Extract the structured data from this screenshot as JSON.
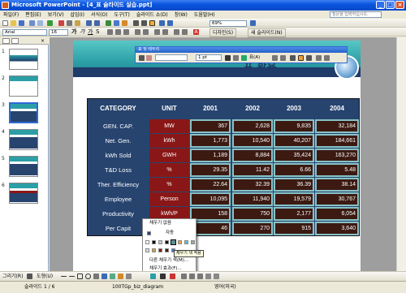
{
  "app": {
    "title": "Microsoft PowerPoint - [4_표 슬라이드 실습.ppt]"
  },
  "menu": [
    "파일(F)",
    "편집(E)",
    "보기(V)",
    "삽입(I)",
    "서식(O)",
    "도구(T)",
    "슬라이드 쇼(D)",
    "창(W)",
    "도움말(H)"
  ],
  "help_box": {
    "placeholder": "질문을 입력하십시오."
  },
  "toolbar": {
    "zoom": "69%",
    "font": "Arial",
    "font_size": "16",
    "design_label": "디자인(S)",
    "new_slide_label": "새 슬라이드(N)"
  },
  "float_toolbar": {
    "title": "표 및 테두리",
    "line_width": "1 pt",
    "table_label": "표(A)"
  },
  "thumbnails": [
    "1",
    "2",
    "3",
    "4",
    "5",
    "6"
  ],
  "table": {
    "headers": [
      "CATEGORY",
      "UNIT",
      "2001",
      "2002",
      "2003",
      "2004"
    ],
    "rows": [
      {
        "category": "GEN. CAP.",
        "unit": "MW",
        "values": [
          "367",
          "2,628",
          "9,835",
          "32,184"
        ]
      },
      {
        "category": "Net. Gen.",
        "unit": "kWh",
        "values": [
          "1,773",
          "10,540",
          "40,207",
          "184,661"
        ]
      },
      {
        "category": "kWh Sold",
        "unit": "GWH",
        "values": [
          "1,189",
          "8,884",
          "35,424",
          "163,270"
        ]
      },
      {
        "category": "T&D Loss",
        "unit": "%",
        "values": [
          "29.35",
          "11.42",
          "6.66",
          "5.48"
        ]
      },
      {
        "category": "Ther. Efficiency",
        "unit": "%",
        "values": [
          "22.64",
          "32.39",
          "36.39",
          "38.14"
        ]
      },
      {
        "category": "Employee",
        "unit": "Person",
        "values": [
          "10,095",
          "11,940",
          "19,579",
          "30,767"
        ]
      },
      {
        "category": "Productivity",
        "unit": "kWh/P",
        "values": [
          "158",
          "750",
          "2,177",
          "6,054"
        ]
      },
      {
        "category": "Per Capit",
        "unit": "",
        "values": [
          "46",
          "270",
          "915",
          "3,640"
        ]
      }
    ]
  },
  "color_menu": {
    "no_fill": "채우기 없음",
    "auto": "자동",
    "tooltip": "채우기 색 적용",
    "more_colors": "다른 채우기 색(M)...",
    "fill_effects": "채우기 효과(F)..."
  },
  "drawbar": {
    "draw_label": "그리기(R)",
    "autoshape_label": "도형(U)"
  },
  "status": {
    "slide": "슬라이드 1 / 6",
    "design": "100TGp_biz_diagram",
    "lang": "영어(미국)"
  },
  "colors": {
    "table_bg": "#27446f",
    "unit_bg": "#8a1717",
    "value_bg": "#3c1a12",
    "value_border": "#88c2c6"
  }
}
